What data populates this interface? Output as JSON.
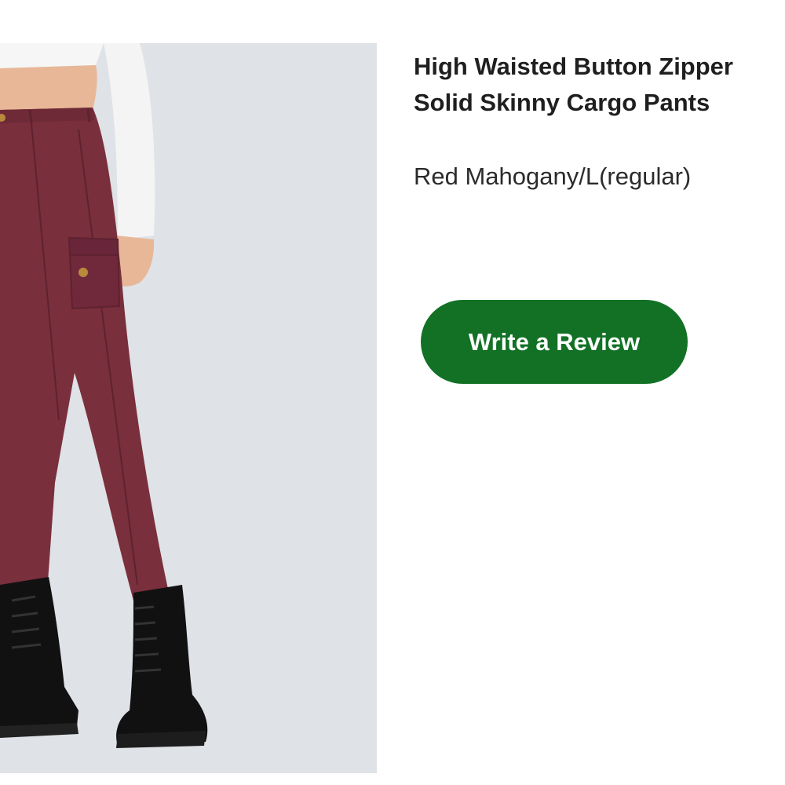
{
  "product": {
    "title_line1": "High Waisted Button Zipper",
    "title_line2": "Solid Skinny Cargo Pants",
    "variant": "Red Mahogany/L(regular)"
  },
  "actions": {
    "review_label": "Write a Review"
  },
  "colors": {
    "accent": "#127125",
    "pants": "#7a2f3c",
    "background": "#dfe2e6"
  }
}
